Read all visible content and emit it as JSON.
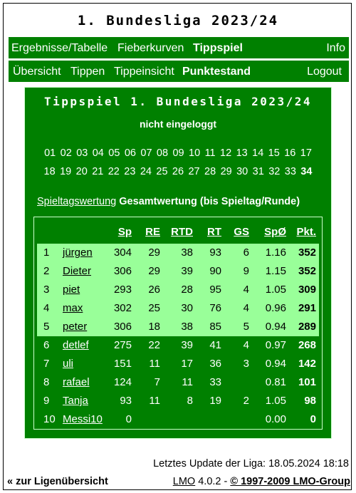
{
  "page_title": "1. Bundesliga 2023/24",
  "nav_top": {
    "items": [
      "Ergebnisse/Tabelle",
      "Fieberkurven",
      "Tippspiel"
    ],
    "right": "Info"
  },
  "nav_sub": {
    "items": [
      "Übersicht",
      "Tippen",
      "Tippeinsicht",
      "Punktestand"
    ],
    "right": "Logout"
  },
  "panel": {
    "title": "Tippspiel 1. Bundesliga 2023/24",
    "status": "nicht eingeloggt",
    "rounds_line1": [
      "01",
      "02",
      "03",
      "04",
      "05",
      "06",
      "07",
      "08",
      "09",
      "10",
      "11",
      "12",
      "13",
      "14",
      "15",
      "16",
      "17"
    ],
    "rounds_line2": [
      "18",
      "19",
      "20",
      "21",
      "22",
      "23",
      "24",
      "25",
      "26",
      "27",
      "28",
      "29",
      "30",
      "31",
      "32",
      "33",
      "34"
    ],
    "current_round": "34",
    "tab_link": "Spieltagswertung",
    "tab_active": "Gesamtwertung (bis Spieltag/Runde)"
  },
  "table": {
    "headers": {
      "sp": "Sp",
      "re": "RE",
      "rtd": "RTD",
      "rt": "RT",
      "gs": "GS",
      "spo": "SpØ",
      "pkt": "Pkt."
    },
    "rows": [
      {
        "rank": "1",
        "name": "jürgen",
        "sp": "304",
        "re": "29",
        "rtd": "38",
        "rt": "93",
        "gs": "6",
        "spo": "1.16",
        "pkt": "352"
      },
      {
        "rank": "2",
        "name": "Dieter",
        "sp": "306",
        "re": "29",
        "rtd": "39",
        "rt": "90",
        "gs": "9",
        "spo": "1.15",
        "pkt": "352"
      },
      {
        "rank": "3",
        "name": "piet",
        "sp": "293",
        "re": "26",
        "rtd": "28",
        "rt": "95",
        "gs": "4",
        "spo": "1.05",
        "pkt": "309"
      },
      {
        "rank": "4",
        "name": "max",
        "sp": "302",
        "re": "25",
        "rtd": "30",
        "rt": "76",
        "gs": "4",
        "spo": "0.96",
        "pkt": "291"
      },
      {
        "rank": "5",
        "name": "peter",
        "sp": "306",
        "re": "18",
        "rtd": "38",
        "rt": "85",
        "gs": "5",
        "spo": "0.94",
        "pkt": "289"
      },
      {
        "rank": "6",
        "name": "detlef",
        "sp": "275",
        "re": "22",
        "rtd": "39",
        "rt": "41",
        "gs": "4",
        "spo": "0.97",
        "pkt": "268"
      },
      {
        "rank": "7",
        "name": "uli",
        "sp": "151",
        "re": "11",
        "rtd": "17",
        "rt": "36",
        "gs": "3",
        "spo": "0.94",
        "pkt": "142"
      },
      {
        "rank": "8",
        "name": "rafael",
        "sp": "124",
        "re": "7",
        "rtd": "11",
        "rt": "33",
        "gs": "",
        "spo": "0.81",
        "pkt": "101"
      },
      {
        "rank": "9",
        "name": "Tanja",
        "sp": "93",
        "re": "11",
        "rtd": "8",
        "rt": "19",
        "gs": "2",
        "spo": "1.05",
        "pkt": "98"
      },
      {
        "rank": "10",
        "name": "Messi10",
        "sp": "0",
        "re": "",
        "rtd": "",
        "rt": "",
        "gs": "",
        "spo": "0.00",
        "pkt": "0"
      }
    ]
  },
  "update_text": "Letztes Update der Liga: 18.05.2024 18:18",
  "footer": {
    "back_link": "« zur Ligenübersicht",
    "lmo": "LMO",
    "version": " 4.0.2 - ",
    "copyright": "© 1997-2009 LMO-Group"
  },
  "colors": {
    "green": "#008000",
    "highlight": "#99ff99"
  }
}
